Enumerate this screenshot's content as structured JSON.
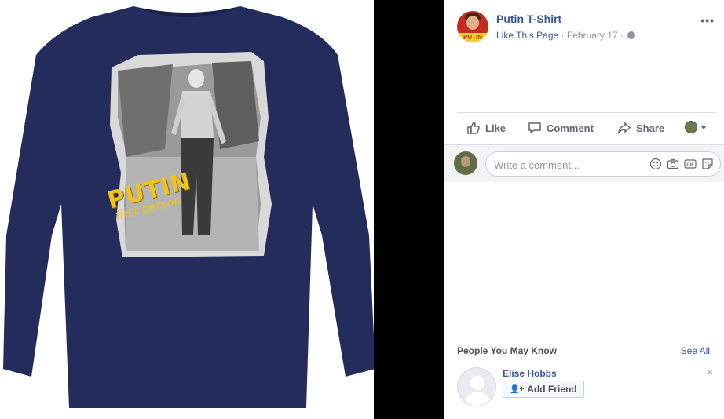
{
  "photo": {
    "print_title": "PUTIN",
    "print_subtitle": "first person",
    "shirt_color": "#242c5c",
    "accent_yellow": "#f2c31b"
  },
  "post": {
    "page_name": "Putin T-Shirt",
    "like_this_page": "Like This Page",
    "date": "February 17",
    "more": "•••",
    "actions": {
      "like": "Like",
      "comment": "Comment",
      "share": "Share"
    },
    "comment_placeholder": "Write a comment..."
  },
  "pymk": {
    "title": "People You May Know",
    "see_all": "See All",
    "person_name": "Elise Hobbs",
    "add_friend": "Add Friend",
    "close": "×"
  },
  "colors": {
    "link_blue": "#365899",
    "muted_gray": "#90949c",
    "divider": "#dadde1"
  }
}
